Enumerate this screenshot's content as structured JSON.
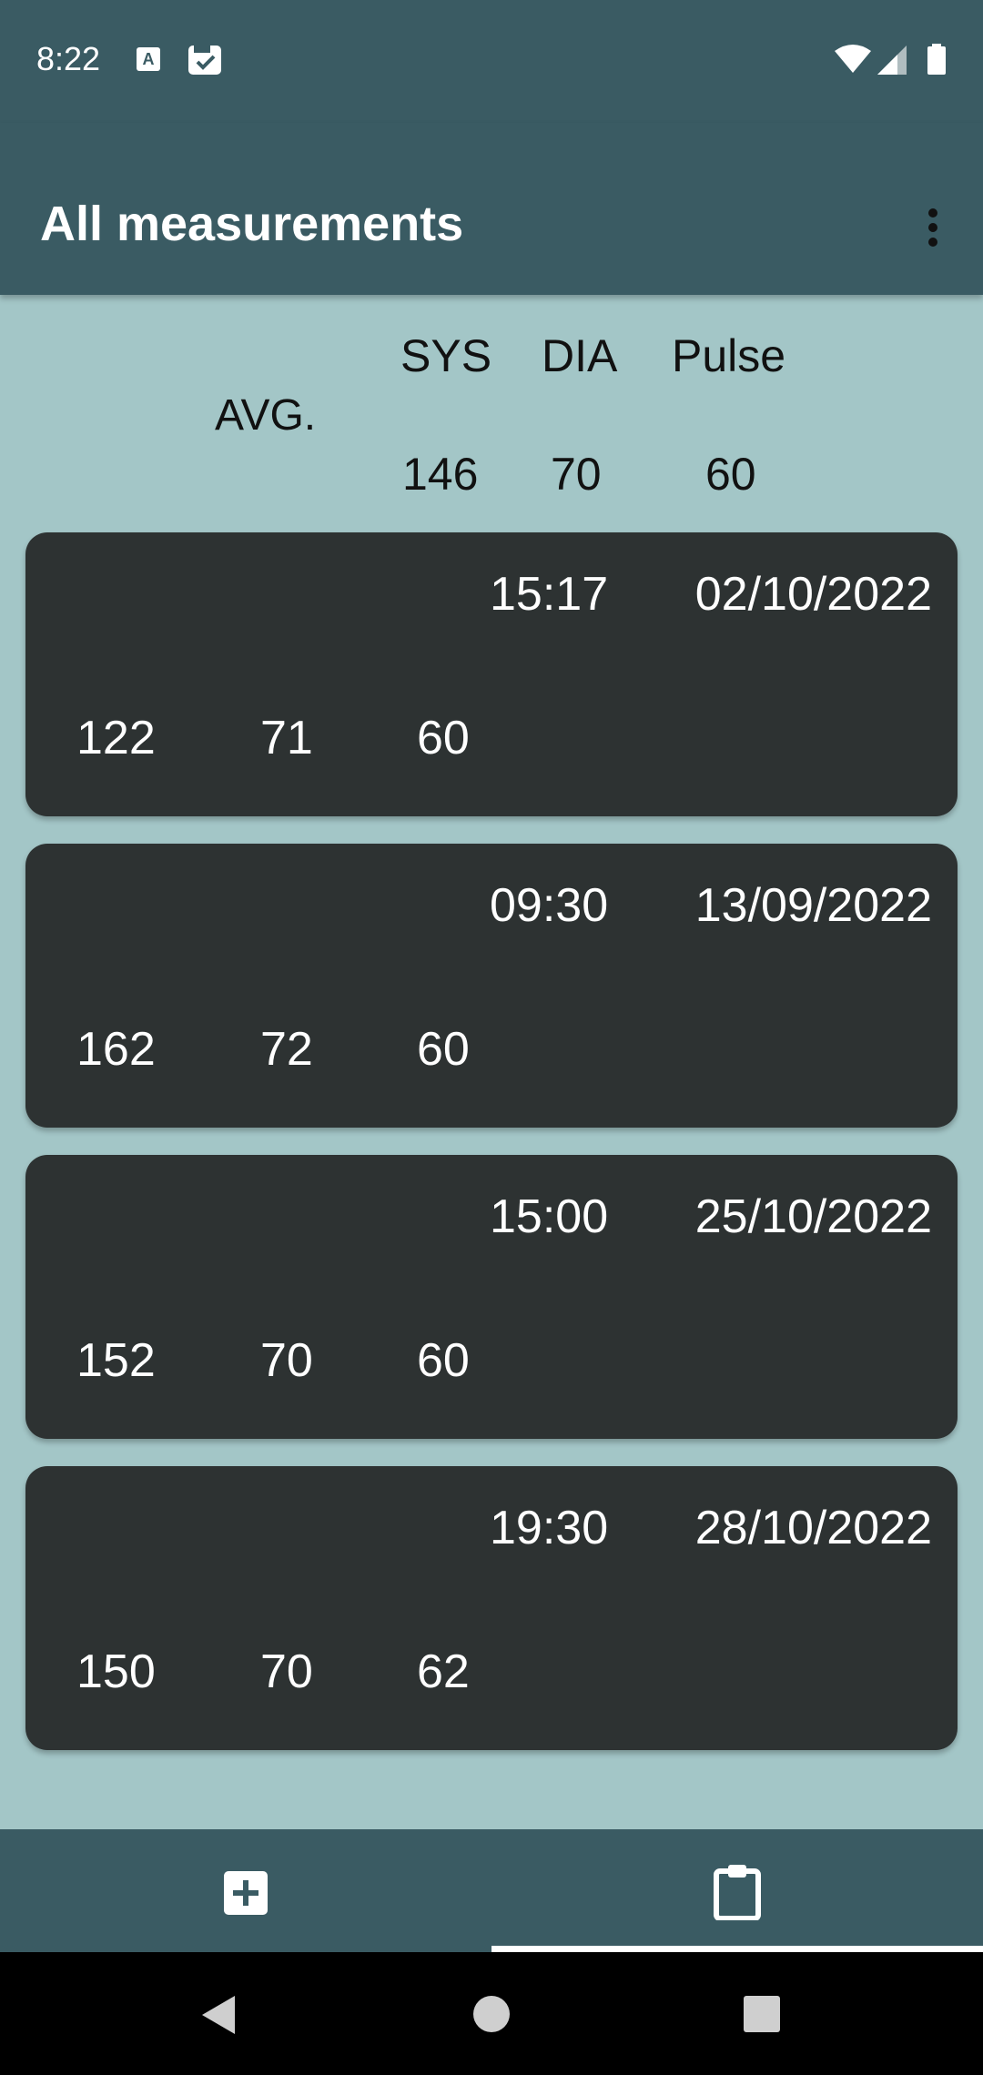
{
  "status_bar": {
    "time": "8:22"
  },
  "app_bar": {
    "title": "All measurements"
  },
  "averages": {
    "label": "AVG.",
    "headers": {
      "sys": "SYS",
      "dia": "DIA",
      "pulse": "Pulse"
    },
    "values": {
      "sys": "146",
      "dia": "70",
      "pulse": "60"
    }
  },
  "measurements": [
    {
      "time": "15:17",
      "date": "02/10/2022",
      "sys": "122",
      "dia": "71",
      "pulse": "60"
    },
    {
      "time": "09:30",
      "date": "13/09/2022",
      "sys": "162",
      "dia": "72",
      "pulse": "60"
    },
    {
      "time": "15:00",
      "date": "25/10/2022",
      "sys": "152",
      "dia": "70",
      "pulse": "60"
    },
    {
      "time": "19:30",
      "date": "28/10/2022",
      "sys": "150",
      "dia": "70",
      "pulse": "62"
    }
  ],
  "bottom_nav": {
    "items": [
      {
        "icon": "add-box-icon",
        "selected": false
      },
      {
        "icon": "clipboard-icon",
        "selected": true
      }
    ]
  },
  "colors": {
    "bar": "#3a5b63",
    "background": "#a3c6c7",
    "card": "#2d3232"
  }
}
